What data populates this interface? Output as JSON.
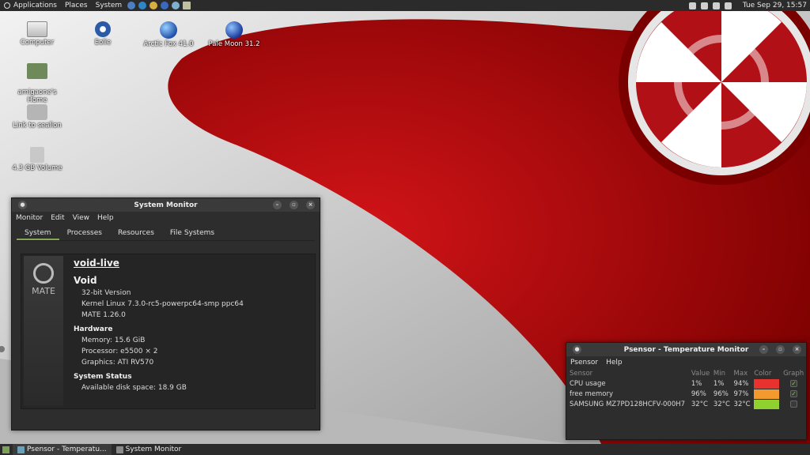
{
  "top_panel": {
    "menus": [
      "Applications",
      "Places",
      "System"
    ],
    "clock": "Tue Sep 29, 15:57"
  },
  "desktop": {
    "icons": [
      {
        "label": "Computer"
      },
      {
        "label": "Eolie"
      },
      {
        "label": "Arctic Fox 41.0"
      },
      {
        "label": "Pale Moon 31.2"
      },
      {
        "label": "amigaone's\nHome"
      },
      {
        "label": "Link to sealion"
      },
      {
        "label": "4.3 GB Volume"
      }
    ]
  },
  "system_monitor": {
    "title": "System Monitor",
    "menu": [
      "Monitor",
      "Edit",
      "View",
      "Help"
    ],
    "tabs": [
      "System",
      "Processes",
      "Resources",
      "File Systems"
    ],
    "logo_text": "MATE",
    "hostname": "void-live",
    "os": "Void",
    "version": "32-bit Version",
    "kernel": "Kernel Linux 7.3.0-rc5-powerpc64-smp ppc64",
    "mate": "MATE 1.26.0",
    "hardware_heading": "Hardware",
    "memory": "Memory:   15.6 GiB",
    "processor": "Processor: e5500 × 2",
    "graphics": "Graphics:  ATI RV570",
    "status_heading": "System Status",
    "disk": "Available disk space: 18.9 GB"
  },
  "psensor": {
    "title": "Psensor - Temperature Monitor",
    "menu": [
      "Psensor",
      "Help"
    ],
    "columns": [
      "Sensor",
      "Value",
      "Min",
      "Max",
      "Color",
      "Graph"
    ],
    "rows": [
      {
        "sensor": "CPU usage",
        "value": "1%",
        "min": "1%",
        "max": "94%",
        "color": "#e8322e",
        "graph": true
      },
      {
        "sensor": "free memory",
        "value": "96%",
        "min": "96%",
        "max": "97%",
        "color": "#f39a2e",
        "graph": true
      },
      {
        "sensor": "SAMSUNG MZ7PD128HCFV-000H7",
        "value": "32°C",
        "min": "32°C",
        "max": "32°C",
        "color": "#8fd12e",
        "graph": false
      }
    ]
  },
  "taskbar": {
    "tasks": [
      "Psensor - Temperatu...",
      "System Monitor"
    ]
  }
}
